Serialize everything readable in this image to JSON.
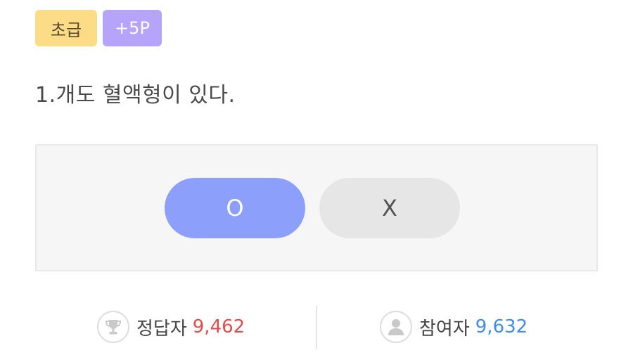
{
  "badges": {
    "level": "초급",
    "points": "+5P"
  },
  "question": {
    "text": "1.개도 혈액형이 있다."
  },
  "answers": {
    "o_label": "O",
    "x_label": "X",
    "selected": "O"
  },
  "stats": {
    "correct_label": "정답자",
    "correct_count": "9,462",
    "participants_label": "참여자",
    "participants_count": "9,632"
  },
  "icons": {
    "correct": "trophy-icon",
    "participants": "user-icon"
  },
  "colors": {
    "level_badge": "#fcdc86",
    "points_badge": "#b6a4fb",
    "o_button": "#8b9ffb",
    "x_button": "#e6e6e6",
    "correct_count": "#e24c4c",
    "participants_count": "#3f8de8"
  }
}
